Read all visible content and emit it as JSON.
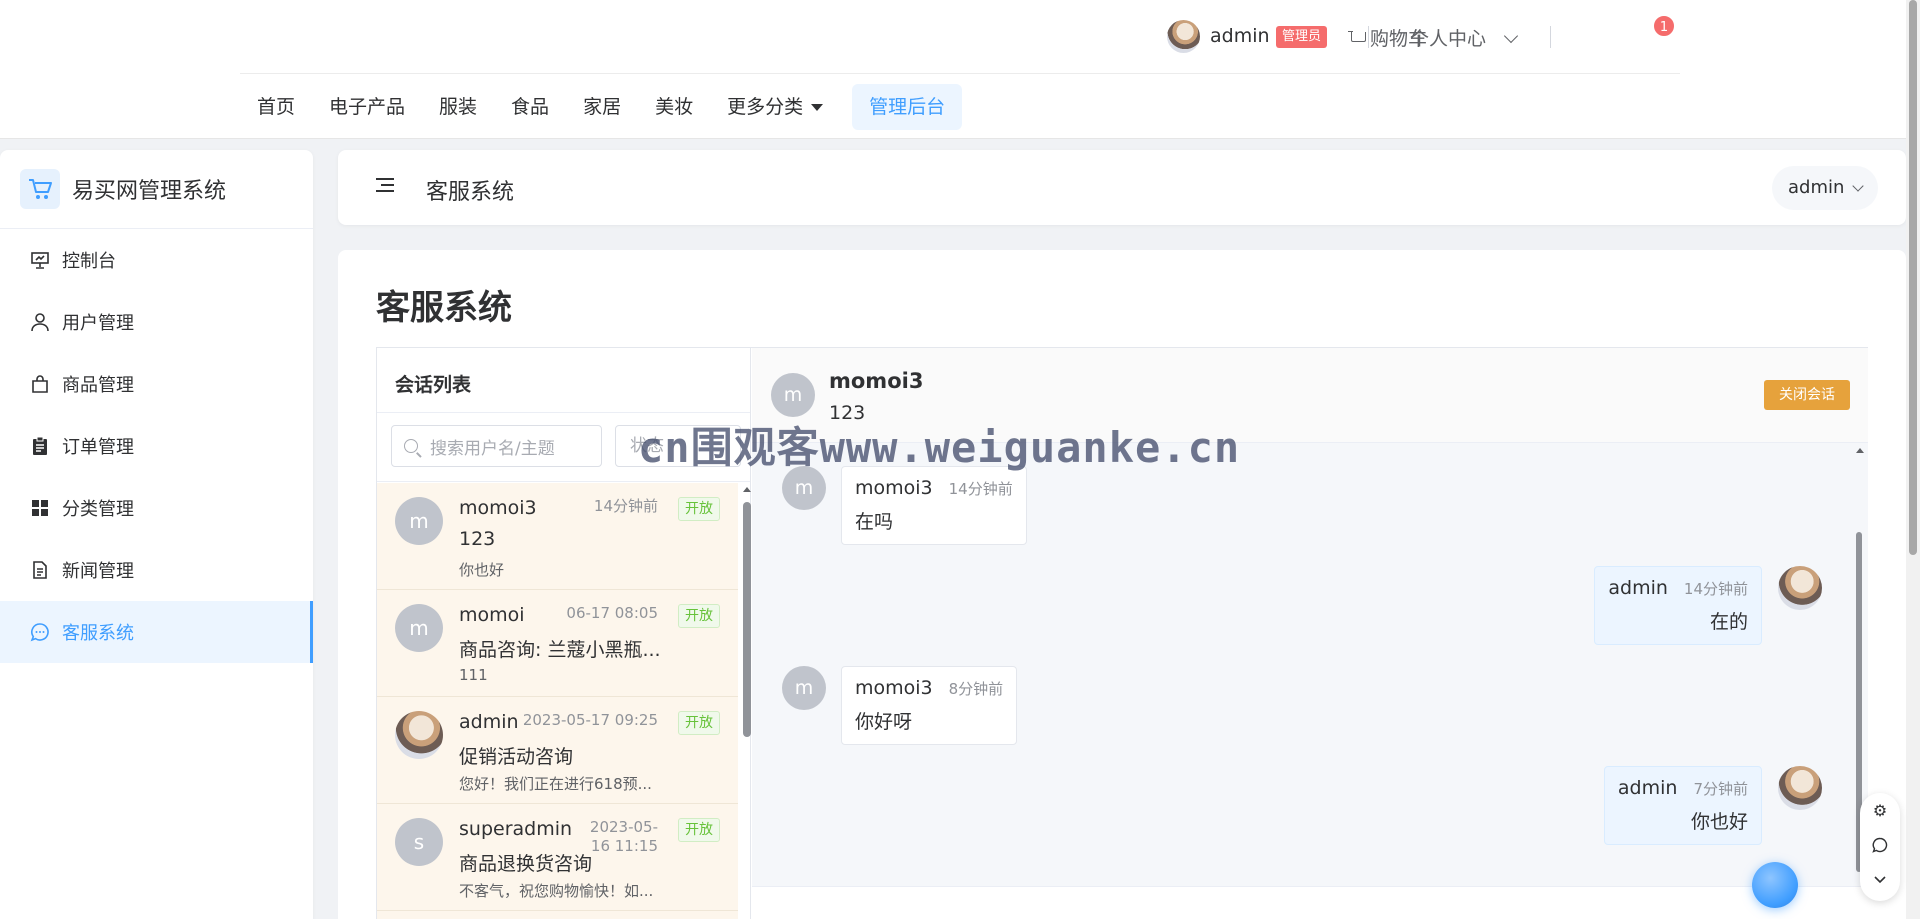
{
  "topbar": {
    "user_name": "admin",
    "user_role": "管理员",
    "personal_center": "个人中心",
    "cart_label": "购物车",
    "cart_count": "1",
    "nav": [
      "首页",
      "电子产品",
      "服装",
      "食品",
      "家居",
      "美妆",
      "更多分类",
      "管理后台"
    ]
  },
  "sidebar": {
    "brand": "易买网管理系统",
    "items": [
      {
        "label": "控制台",
        "icon": "presentation-icon"
      },
      {
        "label": "用户管理",
        "icon": "user-icon"
      },
      {
        "label": "商品管理",
        "icon": "bag-icon"
      },
      {
        "label": "订单管理",
        "icon": "clipboard-icon"
      },
      {
        "label": "分类管理",
        "icon": "grid-icon"
      },
      {
        "label": "新闻管理",
        "icon": "document-icon"
      },
      {
        "label": "客服系统",
        "icon": "chat-icon"
      }
    ],
    "active_index": 6
  },
  "header": {
    "title": "客服系统",
    "user_menu": "admin"
  },
  "main": {
    "page_title": "客服系统",
    "conversations": {
      "title": "会话列表",
      "search_placeholder": "搜索用户名/主题",
      "status_placeholder": "状态",
      "items": [
        {
          "avatar": "m",
          "name": "momoi3",
          "time": "14分钟前",
          "status": "开放",
          "subject": "123",
          "last": "你也好"
        },
        {
          "avatar": "m",
          "name": "momoi",
          "time": "06-17 08:05",
          "status": "开放",
          "subject": "商品咨询: 兰蔻小黑瓶...",
          "last": "111"
        },
        {
          "avatar": "",
          "name": "admin",
          "time": "2023-05-17 09:25",
          "status": "开放",
          "subject": "促销活动咨询",
          "last": "您好！我们正在进行618预..."
        },
        {
          "avatar": "s",
          "name": "superadmin",
          "time": "2023-05-16 11:15",
          "status": "开放",
          "subject": "商品退换货咨询",
          "last": "不客气，祝您购物愉快！如..."
        }
      ]
    },
    "chat": {
      "avatar": "m",
      "name": "momoi3",
      "subject": "123",
      "close_button": "关闭会话",
      "messages": [
        {
          "from": "momoi3",
          "mine": false,
          "avatar": "m",
          "time": "14分钟前",
          "text": "在吗"
        },
        {
          "from": "admin",
          "mine": true,
          "avatar": "",
          "time": "14分钟前",
          "text": "在的"
        },
        {
          "from": "momoi3",
          "mine": false,
          "avatar": "m",
          "time": "8分钟前",
          "text": "你好呀"
        },
        {
          "from": "admin",
          "mine": true,
          "avatar": "",
          "time": "7分钟前",
          "text": "你也好"
        }
      ]
    }
  },
  "watermark": "cn围观客www.weiguanke.cn"
}
